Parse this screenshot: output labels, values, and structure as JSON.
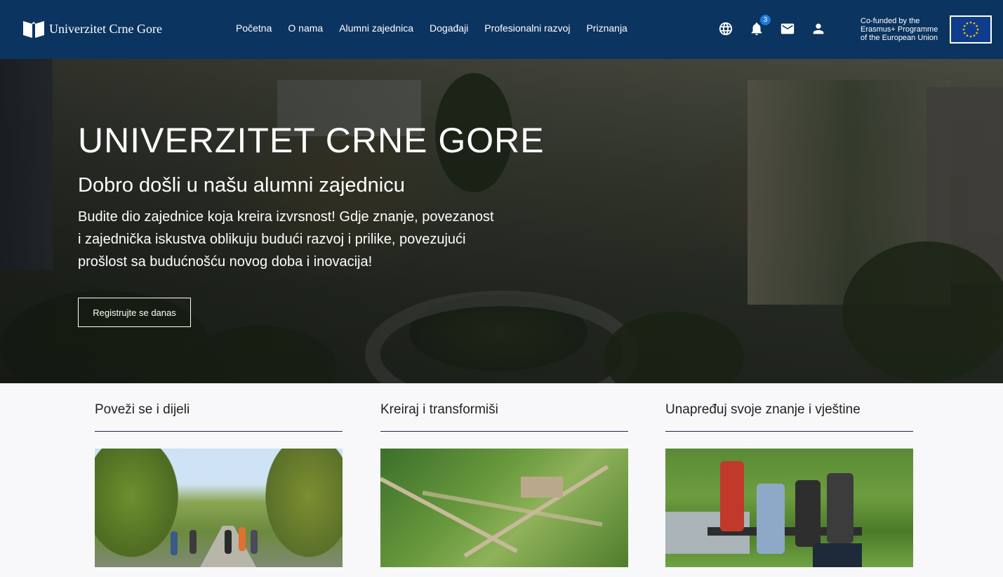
{
  "header": {
    "logo_text": "Univerzitet Crne Gore",
    "nav": [
      "Početna",
      "O nama",
      "Alumni zajednica",
      "Događaji",
      "Profesionalni razvoj",
      "Priznanja"
    ],
    "notifications_count": "3",
    "icons": [
      "globe-icon",
      "bell-icon",
      "mail-icon",
      "user-icon"
    ],
    "erasmus_line1": "Co-funded by the",
    "erasmus_line2": "Erasmus+ Programme",
    "erasmus_line3": "of the European Union"
  },
  "hero": {
    "title": "UNIVERZITET CRNE GORE",
    "subtitle": "Dobro došli u našu alumni zajednicu",
    "text": "Budite dio zajednice koja kreira izvrsnost! Gdje znanje, povezanost i zajednička iskustva oblikuju budući razvoj i prilike, povezujući prošlost sa budućnošću novog doba i inovacija!",
    "button": "Registrujte se danas"
  },
  "cards": [
    {
      "title": "Poveži se i dijeli"
    },
    {
      "title": "Kreiraj i transformiši"
    },
    {
      "title": "Unapređuj svoje znanje i vještine"
    }
  ],
  "colors": {
    "navbar": "#0b3460",
    "badge": "#1f7ad8",
    "eu_flag": "#0f3c8c",
    "eu_stars": "#ffcc00"
  }
}
